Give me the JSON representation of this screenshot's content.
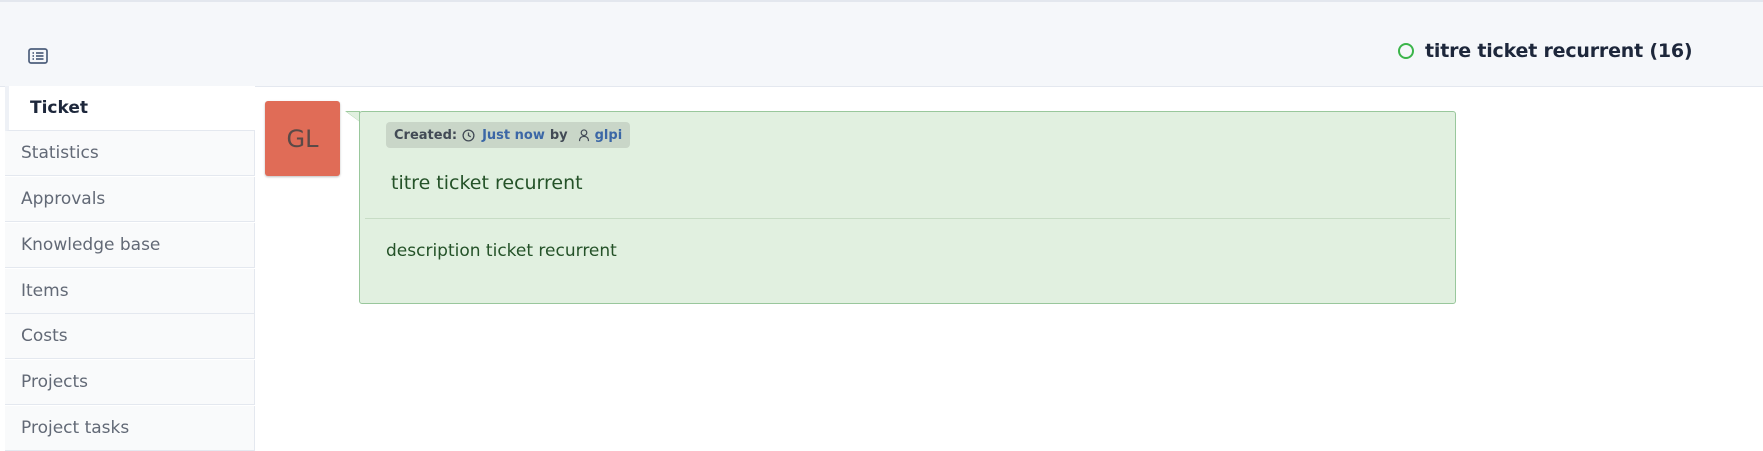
{
  "header": {
    "toggle_icon": "list-icon",
    "status_icon": "open-status-circle-icon",
    "status_color": "#3bb54a",
    "title": "titre ticket recurrent (16)"
  },
  "tabs": [
    {
      "label": "Ticket",
      "active": true
    },
    {
      "label": "Statistics"
    },
    {
      "label": "Approvals"
    },
    {
      "label": "Knowledge base"
    },
    {
      "label": "Items"
    },
    {
      "label": "Costs"
    },
    {
      "label": "Projects"
    },
    {
      "label": "Project tasks"
    }
  ],
  "timeline": {
    "avatar_initials": "GL",
    "avatar_color": "#e06c57",
    "created_label": "Created:",
    "clock_icon": "clock-icon",
    "created_time": "Just now",
    "by_label": "by",
    "user_icon": "user-icon",
    "author": "glpi",
    "title": "titre ticket recurrent",
    "description": "description ticket recurrent",
    "card_color": "#e1f0e0"
  }
}
